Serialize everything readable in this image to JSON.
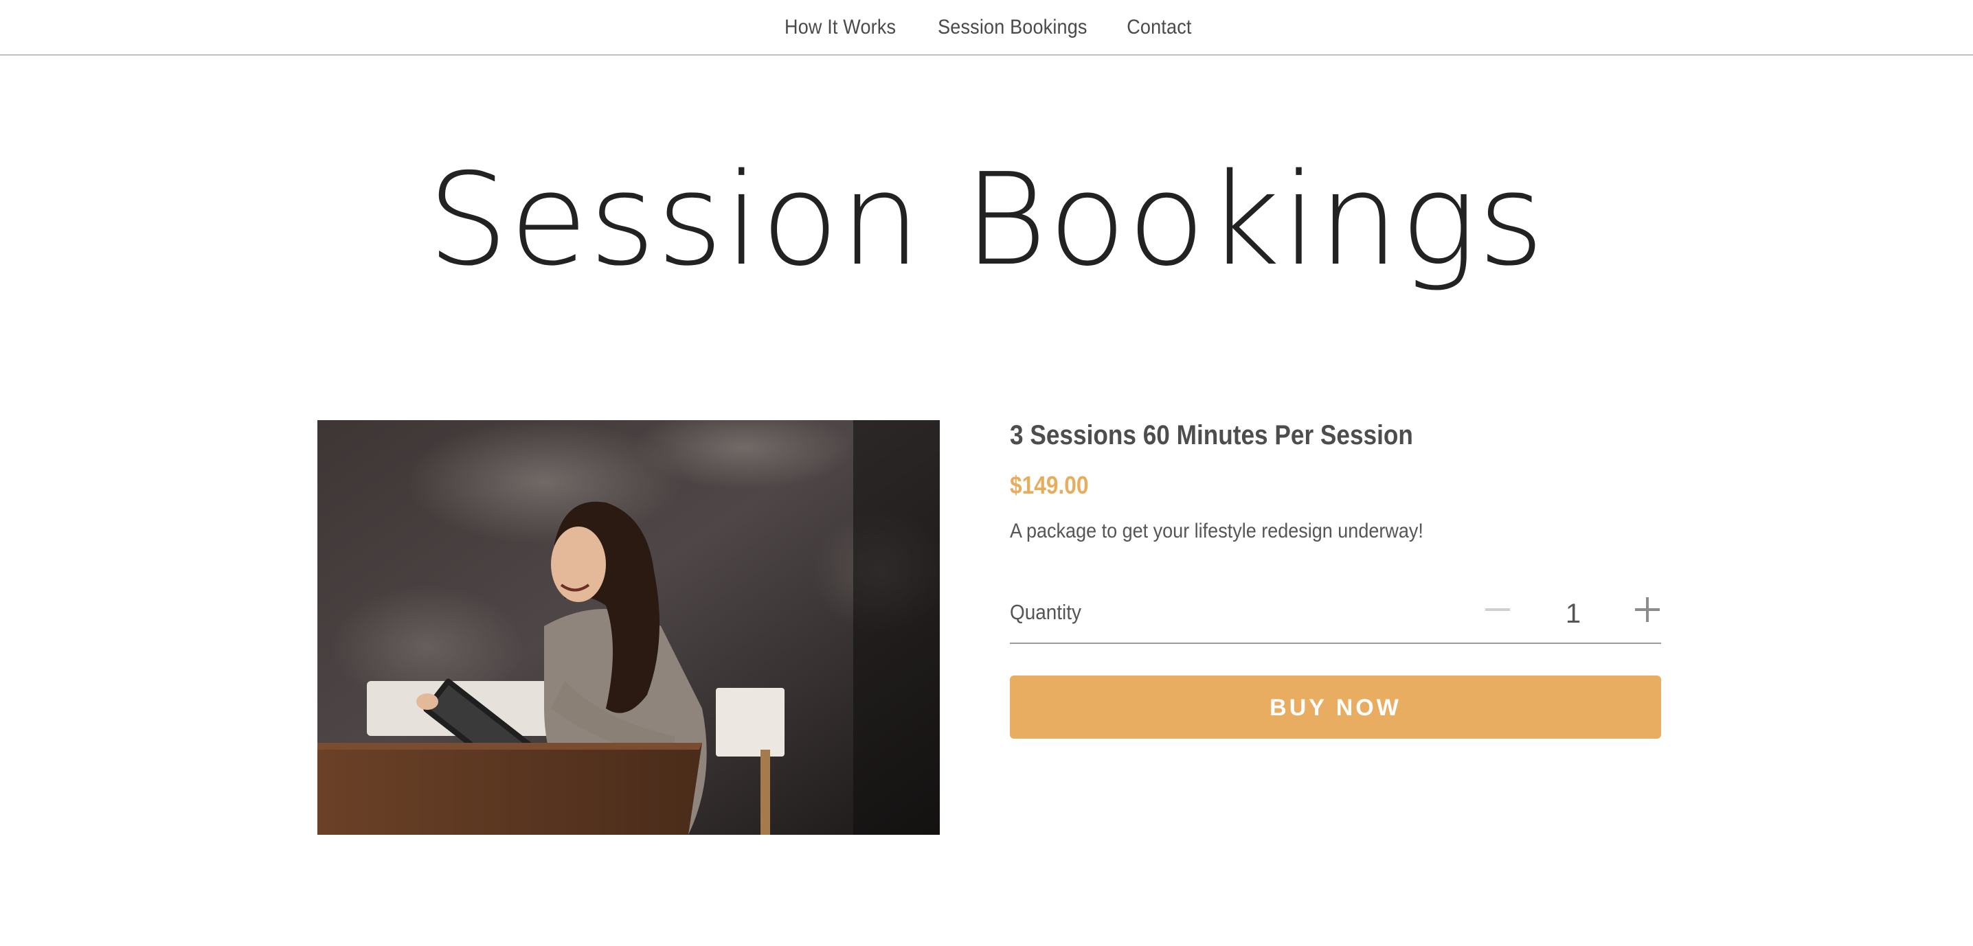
{
  "nav": {
    "items": [
      {
        "label": "How It Works"
      },
      {
        "label": "Session Bookings"
      },
      {
        "label": "Contact"
      }
    ]
  },
  "page": {
    "title": "Session Bookings"
  },
  "product": {
    "name": "3 Sessions 60 Minutes Per Session",
    "price": "$149.00",
    "description": "A package to get your lifestyle redesign underway!",
    "quantity_label": "Quantity",
    "quantity_value": "1",
    "buy_label": "BUY NOW",
    "image_icon": "photo-woman-with-notebook"
  },
  "colors": {
    "accent": "#e8ad61",
    "price": "#e8ad5c",
    "text": "#4d4d4d"
  }
}
